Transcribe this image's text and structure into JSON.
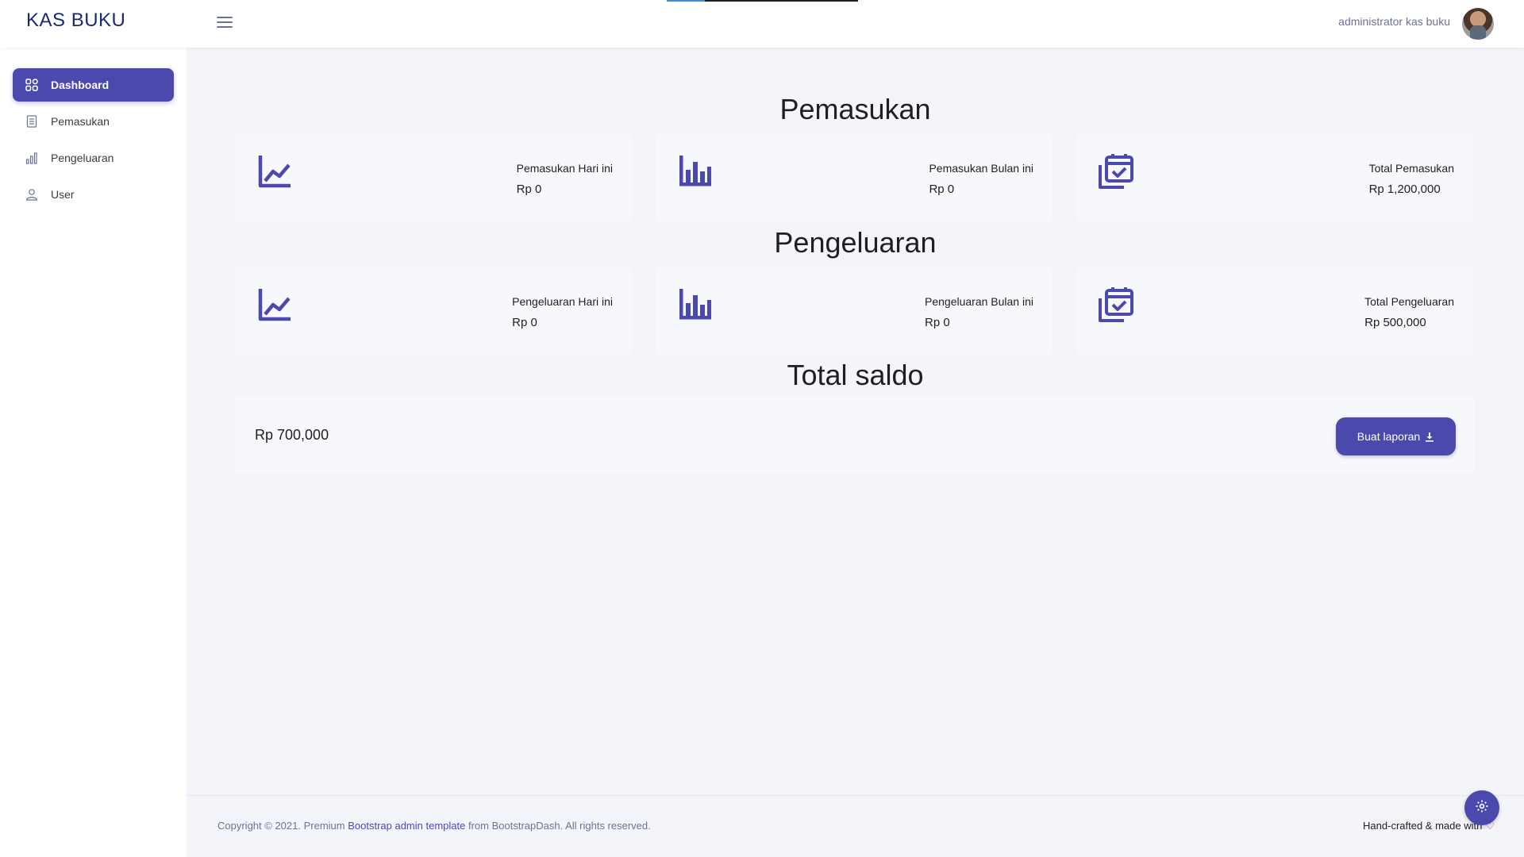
{
  "app": {
    "brand": "KAS BUKU"
  },
  "header": {
    "username": "administrator kas buku"
  },
  "sidebar": {
    "items": [
      {
        "label": "Dashboard",
        "icon": "grid-icon",
        "active": true
      },
      {
        "label": "Pemasukan",
        "icon": "document-icon",
        "active": false
      },
      {
        "label": "Pengeluaran",
        "icon": "bar-chart-icon",
        "active": false
      },
      {
        "label": "User",
        "icon": "user-icon",
        "active": false
      }
    ]
  },
  "pemasukan": {
    "title": "Pemasukan",
    "cards": [
      {
        "label": "Pemasukan Hari ini",
        "value": "Rp 0",
        "icon": "line-chart-icon"
      },
      {
        "label": "Pemasukan Bulan ini",
        "value": "Rp 0",
        "icon": "bar-chart-icon"
      },
      {
        "label": "Total Pemasukan",
        "value": "Rp 1,200,000",
        "icon": "calendar-check-icon"
      }
    ]
  },
  "pengeluaran": {
    "title": "Pengeluaran",
    "cards": [
      {
        "label": "Pengeluaran Hari ini",
        "value": "Rp 0",
        "icon": "line-chart-icon"
      },
      {
        "label": "Pengeluaran Bulan ini",
        "value": "Rp 0",
        "icon": "bar-chart-icon"
      },
      {
        "label": "Total Pengeluaran",
        "value": "Rp 500,000",
        "icon": "calendar-check-icon"
      }
    ]
  },
  "saldo": {
    "title": "Total saldo",
    "value": "Rp 700,000",
    "button_label": "Buat laporan"
  },
  "footer": {
    "copyright_prefix": "Copyright © 2021. Premium",
    "copyright_link": "Bootstrap admin template",
    "copyright_suffix": "from BootstrapDash. All rights reserved.",
    "handcrafted": "Hand-crafted & made with"
  },
  "colors": {
    "accent": "#4b49ac",
    "brand_text": "#1b2a6b",
    "background": "#f4f5fa"
  }
}
